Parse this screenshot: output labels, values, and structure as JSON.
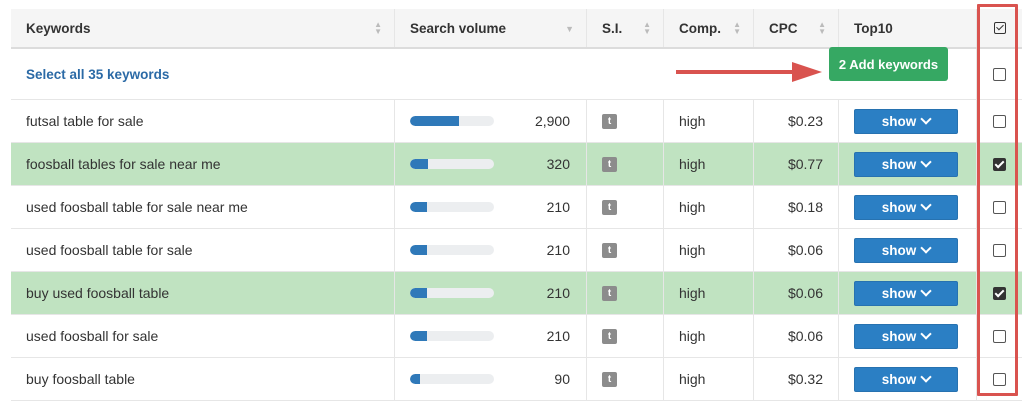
{
  "columns": {
    "keywords": "Keywords",
    "search_volume": "Search volume",
    "si": "S.I.",
    "comp": "Comp.",
    "cpc": "CPC",
    "top10": "Top10"
  },
  "action_row": {
    "select_all": "Select all 35 keywords",
    "add_button": "2 Add keywords"
  },
  "show_label": "show",
  "si_badge": "t",
  "colors": {
    "accent_blue": "#2b7fc4",
    "selected_row": "#c0e3c1",
    "add_green": "#36a863",
    "highlight_red": "#d9534f"
  },
  "rows": [
    {
      "keyword": "futsal table for sale",
      "volume": "2,900",
      "volume_fraction": 0.58,
      "comp": "high",
      "cpc": "$0.23",
      "checked": false
    },
    {
      "keyword": "foosball tables for sale near me",
      "volume": "320",
      "volume_fraction": 0.22,
      "comp": "high",
      "cpc": "$0.77",
      "checked": true
    },
    {
      "keyword": "used foosball table for sale near me",
      "volume": "210",
      "volume_fraction": 0.2,
      "comp": "high",
      "cpc": "$0.18",
      "checked": false
    },
    {
      "keyword": "used foosball table for sale",
      "volume": "210",
      "volume_fraction": 0.2,
      "comp": "high",
      "cpc": "$0.06",
      "checked": false
    },
    {
      "keyword": "buy used foosball table",
      "volume": "210",
      "volume_fraction": 0.2,
      "comp": "high",
      "cpc": "$0.06",
      "checked": true
    },
    {
      "keyword": "used foosball for sale",
      "volume": "210",
      "volume_fraction": 0.2,
      "comp": "high",
      "cpc": "$0.06",
      "checked": false
    },
    {
      "keyword": "buy foosball table",
      "volume": "90",
      "volume_fraction": 0.12,
      "comp": "high",
      "cpc": "$0.32",
      "checked": false
    }
  ]
}
